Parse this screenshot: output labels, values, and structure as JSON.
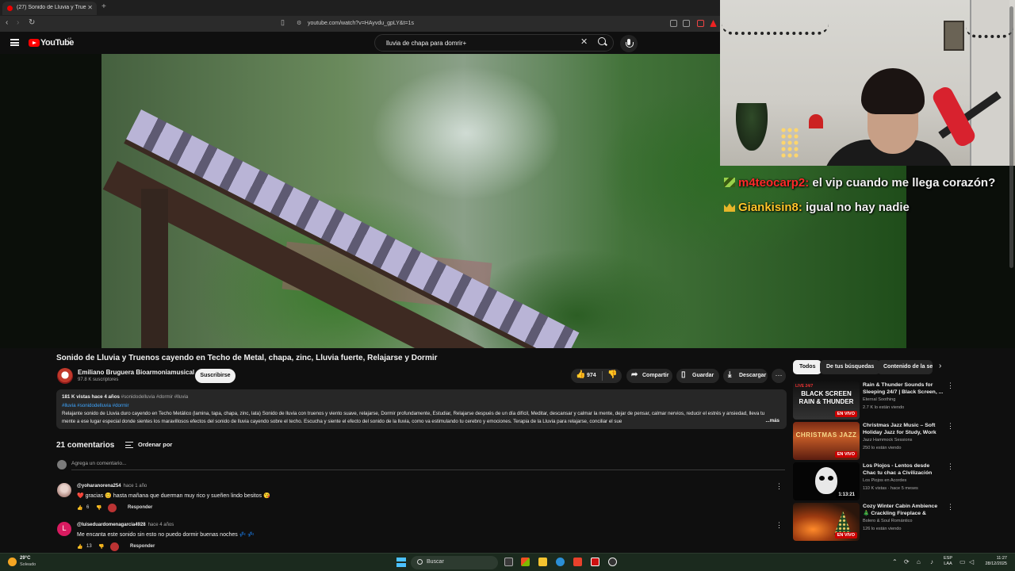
{
  "browser": {
    "tab_title": "(27) Sonido de Lluvia y Truenos c",
    "url": "youtube.com/watch?v=HAyvdu_gpLY&t=1s"
  },
  "youtube": {
    "logo_text": "YouTube",
    "country_code": "AR",
    "search_query": "lluvia de chapa para domrir+"
  },
  "stream_overlay": {
    "chat": [
      {
        "user": "m4teocarp2:",
        "message": " el vip cuando me llega corazón?",
        "user_color": "#ff2a2a"
      },
      {
        "user": "Giankisin8:",
        "message": " igual no hay nadie",
        "user_color": "#ffc629"
      }
    ]
  },
  "video": {
    "title": "Sonido de Lluvia y Truenos cayendo en Techo de Metal, chapa, zinc, Lluvia fuerte, Relajarse y Dormir",
    "channel": "Emiliano Bruguera Bioarmoniamusical",
    "subscribers": "97.8 K suscriptores",
    "subscribe_label": "Suscribirse",
    "likes": "974",
    "share_label": "Compartir",
    "save_label": "Guardar",
    "download_label": "Descargar",
    "more_label": "···"
  },
  "description": {
    "meta": "181 K vistas  hace 4 años",
    "meta_tags": " #sonidodelluvia #dormir #lluvia",
    "hashtags": "#lluvia #sonidodelluvia #dormir",
    "text": "Relajante sonido de Lluvia duro cayendo en Techo Metálico (lamina, tapa, chapa, zinc, lata) Sonido de lluvia con truenos y viento suave, relajarse, Dormir profundamente, Estudiar, Relajarse después de un día difícil, Meditar, descansar y calmar la mente, dejar de pensar, calmar nervios,  reducir el estrés y ansiedad, lleva tu mente a ese lugar especial donde sientes los maravillosos efectos del sonido de lluvia cayendo sobre el techo. Escucha y siente el efecto del sonido de la lluvia, como va estimulando tu cerebro y emociones. Terapia de la Lluvia para relajarse, conciliar el sue",
    "more": "...más"
  },
  "comments": {
    "count": "21 comentarios",
    "sort_label": "Ordenar por",
    "add_placeholder": "Agrega un comentario...",
    "items": [
      {
        "user": "@yoharanorena254",
        "ago": "hace 1 año",
        "text": "❤️ gracias 😊 hasta mañana que duerman muy rico y sueñen lindo besitos 😘",
        "likes": "6",
        "reply": "Responder",
        "avatar_color": "#c9a7a0"
      },
      {
        "user": "@luiseduardomenagarcia4928",
        "ago": "hace 4 años",
        "text": "Me encanta este sonido sin esto no puedo dormir buenas noches 💤 💤",
        "likes": "13",
        "reply": "Responder",
        "avatar_color": "#d81b60",
        "avatar_letter": "L"
      }
    ]
  },
  "sidebar": {
    "chips": [
      "Todos",
      "De tus búsquedas",
      "Contenido de la se"
    ],
    "recommendations": [
      {
        "title": "Rain & Thunder Sounds for Sleeping 24/7 | Black Screen, ...",
        "channel": "Eternal Soothing",
        "stats": "2.7 K lo están viendo",
        "badge": "EN VIVO",
        "thumb_top": "LIVE 24/7",
        "thumb_text": "BLACK SCREEN RAIN & THUNDER"
      },
      {
        "title": "Christmas Jazz Music – Soft Holiday Jazz for Study, Work &...",
        "channel": "Jazz Hammock Sessions",
        "stats": "250 lo están viendo",
        "badge": "EN VIVO",
        "thumb_text": "CHRISTMAS JAZZ"
      },
      {
        "title": "Los Piojos - Lentos desde Chac tu chac a Civilización",
        "channel": "Los Piojos en Acordes",
        "stats": "110 K vistas · hace 5 meses",
        "badge": "1:13:21"
      },
      {
        "title": "Cozy Winter Cabin Ambience 🎄 Crackling Fireplace & Gentl...",
        "channel": "Bolero & Soul Romántico",
        "stats": "126 lo están viendo",
        "badge": "EN VIVO"
      }
    ]
  },
  "taskbar": {
    "temperature": "29°C",
    "weather": "Soleado",
    "search_label": "Buscar",
    "lang_top": "ESP",
    "lang_bottom": "LAA",
    "time": "11:27",
    "date": "28/12/2025"
  }
}
